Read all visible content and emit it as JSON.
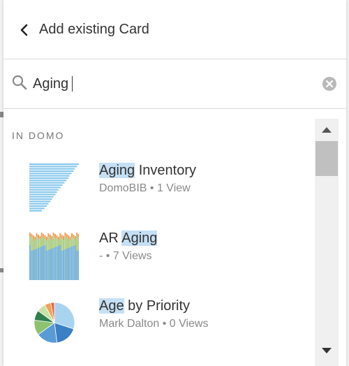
{
  "header": {
    "title": "Add existing Card"
  },
  "search": {
    "value": "Aging",
    "placeholder": ""
  },
  "section_label": "IN DOMO",
  "results": [
    {
      "title_highlight": "Aging",
      "title_rest": " Inventory",
      "meta": "DomoBIB • 1 View",
      "thumbnail_icon": "horizontal-bar-chart-thumbnail",
      "bar_fractions": [
        1.0,
        0.95,
        0.9,
        0.88,
        0.84,
        0.8,
        0.78,
        0.74,
        0.7,
        0.66,
        0.62,
        0.58,
        0.55,
        0.52,
        0.48,
        0.45,
        0.42,
        0.38,
        0.35,
        0.3,
        0.25
      ],
      "colors": {
        "bar": "#86c6ec"
      }
    },
    {
      "title_prefix": "AR ",
      "title_highlight": "Aging",
      "meta": "- • 7 Views",
      "thumbnail_icon": "stacked-column-chart-thumbnail",
      "colors": {
        "base": "#74b5e2",
        "mid": "#a8d18b",
        "top": "#f39c54"
      }
    },
    {
      "title_highlight": "Age",
      "title_rest": " by Priority",
      "meta": "Mark Dalton • 0 Views",
      "thumbnail_icon": "pie-chart-thumbnail",
      "colors": {
        "slices": [
          "#a9d4f0",
          "#3b7fc4",
          "#5b9bd5",
          "#8dc26f",
          "#2f7f4f",
          "#c6e2a6",
          "#f2a253",
          "#e86a4a"
        ]
      }
    }
  ],
  "icons": {
    "back": "chevron-left-icon",
    "search": "search-icon",
    "clear": "clear-icon",
    "scroll_up": "triangle-up-icon",
    "scroll_down": "triangle-down-icon"
  },
  "colors": {
    "highlight": "#c5e0f5",
    "divider": "#dadada"
  }
}
